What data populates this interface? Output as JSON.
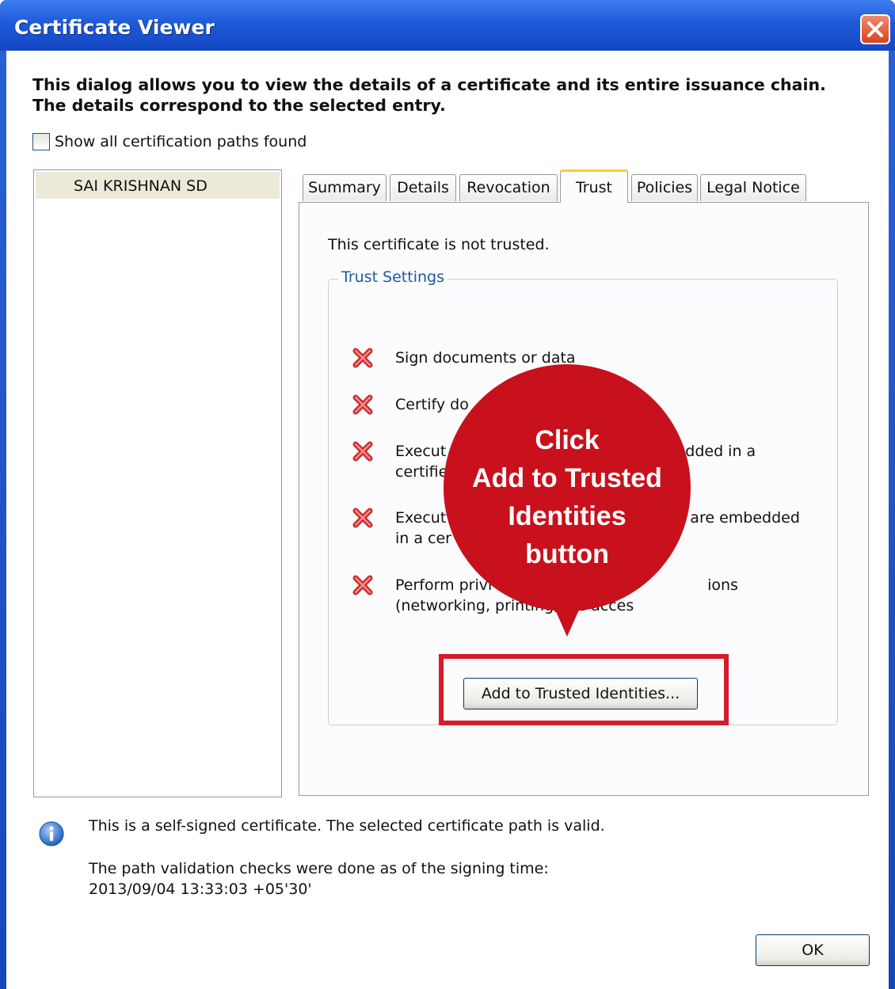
{
  "window": {
    "title": "Certificate Viewer",
    "close_icon": "close-icon"
  },
  "intro": "This dialog allows you to view the details of a certificate and its entire issuance chain. The details correspond to the selected entry.",
  "show_all": {
    "label": "Show all certification paths found",
    "checked": false
  },
  "tree": {
    "items": [
      {
        "label": "SAI KRISHNAN SD",
        "selected": true
      }
    ]
  },
  "tabs": [
    {
      "label": "Summary",
      "active": false
    },
    {
      "label": "Details",
      "active": false
    },
    {
      "label": "Revocation",
      "active": false
    },
    {
      "label": "Trust",
      "active": true
    },
    {
      "label": "Policies",
      "active": false
    },
    {
      "label": "Legal Notice",
      "active": false
    }
  ],
  "trust": {
    "status": "This certificate is not trusted.",
    "group_title": "Trust Settings",
    "permissions": [
      {
        "text": "Sign documents or data",
        "icon": "red-x-icon"
      },
      {
        "text": "Certify do",
        "icon": "red-x-icon"
      },
      {
        "text": "Execut                                                  dded in a certifie",
        "icon": "red-x-icon"
      },
      {
        "text": "Execut                                                   are embedded in a cer",
        "icon": "red-x-icon"
      },
      {
        "text": "Perform privi                                             ions (networking, printing, file acces",
        "icon": "red-x-icon"
      }
    ],
    "add_button": "Add to Trusted Identities..."
  },
  "callout": {
    "lines": [
      "Click",
      "Add to Trusted",
      "Identities",
      "button"
    ],
    "color": "#c8111c"
  },
  "info": {
    "icon": "info-icon",
    "self_signed": "This is a self-signed certificate. The selected certificate path is valid.",
    "path_line1": "The path validation checks were done as of the signing time:",
    "path_line2": "2013/09/04 13:33:03 +05'30'"
  },
  "ok_button": "OK"
}
